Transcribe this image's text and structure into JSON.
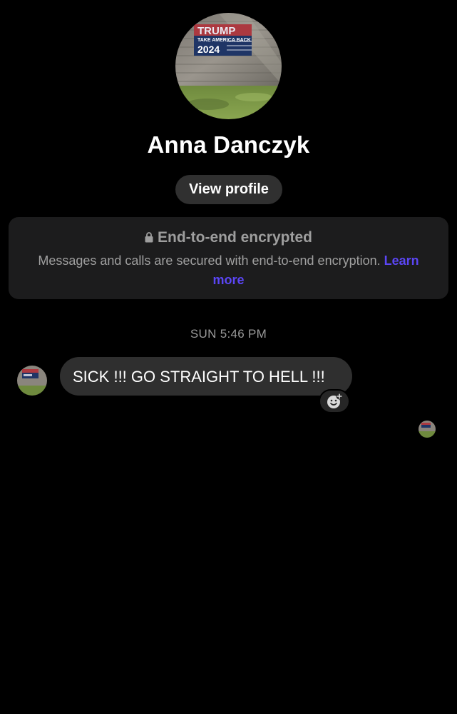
{
  "contact": {
    "name": "Anna Danczyk",
    "avatar_icon": "profile-photo-icon",
    "avatar_sign_lines": [
      "TRUMP",
      "TAKE AMERICA BACK",
      "2024"
    ]
  },
  "header": {
    "view_profile_label": "View profile"
  },
  "encryption": {
    "title": "End-to-end encrypted",
    "description": "Messages and calls are secured with end-to-end encryption.",
    "learn_more": "Learn more",
    "icon": "lock-icon"
  },
  "conversation": {
    "timestamp": "SUN 5:46 PM",
    "messages": [
      {
        "text": "SICK !!! GO STRAIGHT TO HELL !!!",
        "direction": "incoming"
      }
    ],
    "reaction_icon": "add-reaction-icon",
    "read_receipt_icon": "read-receipt-avatar-icon"
  },
  "colors": {
    "background": "#000000",
    "bubble": "#2f2f2f",
    "card": "#1c1c1d",
    "link": "#5b46f5",
    "muted_text": "#9e9e9e"
  }
}
